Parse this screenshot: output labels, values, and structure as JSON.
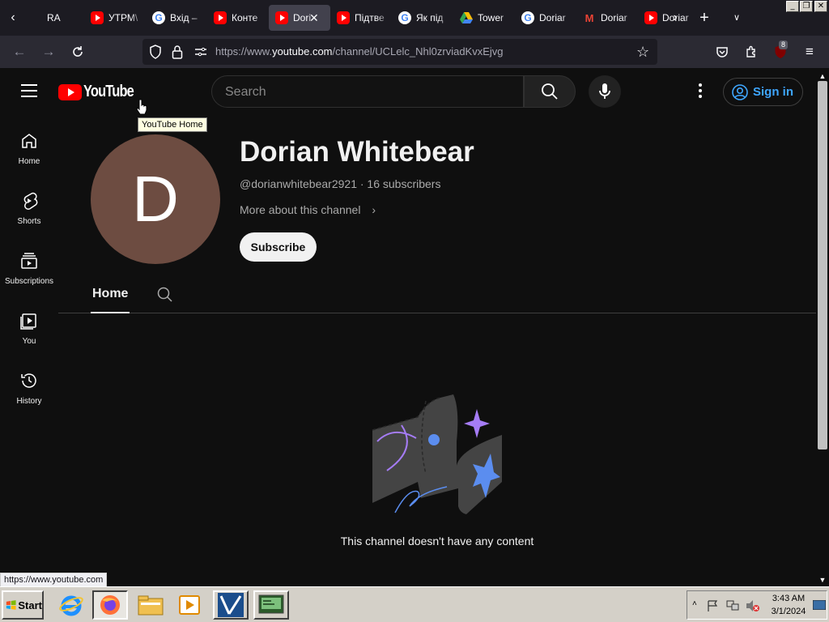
{
  "browser": {
    "tabs": [
      {
        "title": "RA",
        "favicon": "generic",
        "active": false
      },
      {
        "title": "УТРМ\\",
        "favicon": "youtube",
        "active": false
      },
      {
        "title": "Вхід –",
        "favicon": "google",
        "active": false
      },
      {
        "title": "Конте",
        "favicon": "youtube",
        "active": false
      },
      {
        "title": "Dori",
        "favicon": "youtube",
        "active": true
      },
      {
        "title": "Підтве",
        "favicon": "youtube",
        "active": false
      },
      {
        "title": "Як під",
        "favicon": "google",
        "active": false
      },
      {
        "title": "Tower",
        "favicon": "google-drive",
        "active": false
      },
      {
        "title": "Doriar",
        "favicon": "google",
        "active": false
      },
      {
        "title": "Doriar",
        "favicon": "gmail",
        "active": false
      },
      {
        "title": "Doriar",
        "favicon": "youtube",
        "active": false
      }
    ],
    "url_prefix": "https://www.",
    "url_domain": "youtube.com",
    "url_path": "/channel/UCLelc_Nhl0zrviadKvxEjvg",
    "extension_badge": "8",
    "status_url": "https://www.youtube.com"
  },
  "youtube": {
    "logo_text": "YouTube",
    "tooltip": "YouTube Home",
    "search_placeholder": "Search",
    "sign_in": "Sign in",
    "sidebar": [
      {
        "label": "Home",
        "icon": "home-icon"
      },
      {
        "label": "Shorts",
        "icon": "shorts-icon"
      },
      {
        "label": "Subscriptions",
        "icon": "subscriptions-icon"
      },
      {
        "label": "You",
        "icon": "you-icon"
      },
      {
        "label": "History",
        "icon": "history-icon"
      }
    ],
    "channel": {
      "avatar_letter": "D",
      "avatar_color": "#6d4c41",
      "name": "Dorian Whitebear",
      "meta": "@dorianwhitebear2921 · 16 subscribers",
      "about": "More about this channel",
      "subscribe": "Subscribe"
    },
    "tabs": {
      "home": "Home"
    },
    "empty_message": "This channel doesn't have any content"
  },
  "taskbar": {
    "start": "Start",
    "time": "3:43 AM",
    "date": "3/1/2024"
  },
  "colors": {
    "yt_red": "#ff0000",
    "yt_bg": "#0f0f0f",
    "link_blue": "#3ea6ff"
  }
}
